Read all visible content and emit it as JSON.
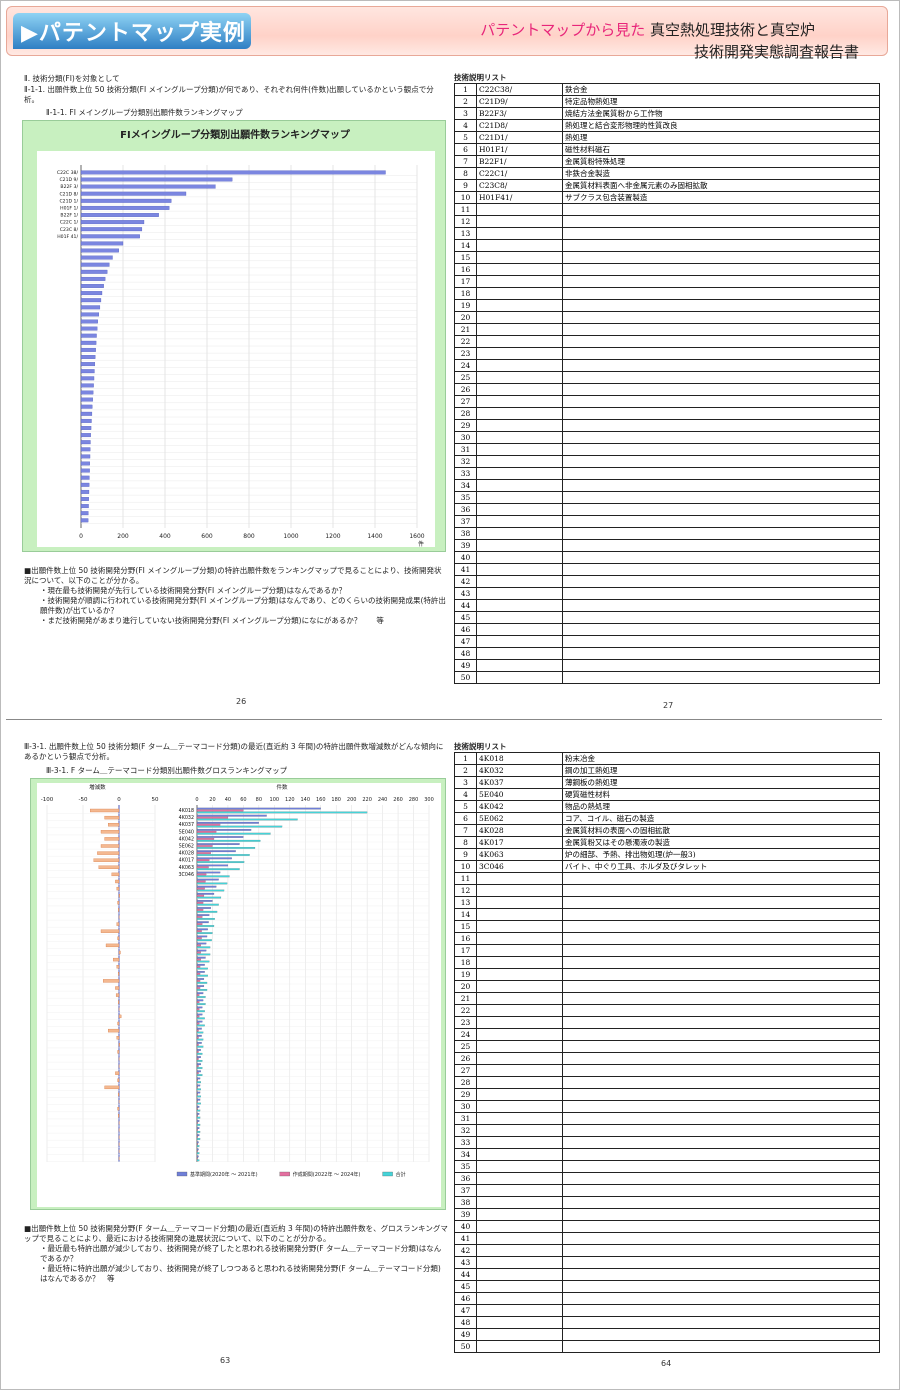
{
  "banner": {
    "title": "▶パテントマップ実例",
    "subtitle_pink": "パテントマップから見た",
    "subtitle_black": "真空熱処理技術と真空炉",
    "subtitle_line2": "技術開発実態調査報告書"
  },
  "page1": {
    "heading1": "Ⅱ. 技術分類(FI)を対象として",
    "heading2": "Ⅱ-1-1. 出願件数上位 50 技術分類(FI メイングループ分類)が何であり、それぞれ何件(件数)出願しているかという観点で分析。",
    "figure_caption": "Ⅱ-1-1. FI メイングループ分類別出願件数ランキングマップ",
    "chart_title": "FIメイングループ分類別出願件数ランキングマップ",
    "notes": [
      "■出願件数上位 50 技術開発分野(FI メイングループ分類)の特許出願件数をランキングマップで見ることにより、技術開発状況について、以下のことが分かる。",
      "・現在最も技術開発が先行している技術開発分野(FI メイングループ分類)はなんであるか？",
      "・技術開発が順調に行われている技術開発分野(FI メイングループ分類)はなんであり、どのくらいの技術開発成果(特許出願件数)が出ているか？",
      "・まだ技術開発があまり進行していない技術開発分野(FI メイングループ分類)になにがあるか？　　等"
    ],
    "page_left": "26",
    "page_right": "27",
    "list_title": "技術説明リスト",
    "list": [
      {
        "code": "C22C38/",
        "desc": "鉄合金"
      },
      {
        "code": "C21D9/",
        "desc": "特定品物熱処理"
      },
      {
        "code": "B22F3/",
        "desc": "焼結方法金属質粉から工作物"
      },
      {
        "code": "C21D8/",
        "desc": "熱処理と結合変形物理的性質改良"
      },
      {
        "code": "C21D1/",
        "desc": "熱処理"
      },
      {
        "code": "H01F1/",
        "desc": "磁性材料磁石"
      },
      {
        "code": "B22F1/",
        "desc": "金属質粉特殊処理"
      },
      {
        "code": "C22C1/",
        "desc": "非鉄合金製造"
      },
      {
        "code": "C23C8/",
        "desc": "金属質材料表面へ非金属元素のみ固相拡散"
      },
      {
        "code": "H01F41/",
        "desc": "サブクラス包含装置製造"
      }
    ]
  },
  "page2": {
    "heading": "Ⅲ-3-1. 出願件数上位 50 技術分類(F ターム＿テーマコード分類)の最近(直近約 3 年間)の特許出願件数増減数がどんな傾向にあるかという観点で分析。",
    "figure_caption": "Ⅲ-3-1. F ターム＿テーマコード分類別出願件数グロスランキングマップ",
    "notes": [
      "■出願件数上位 50 技術開発分野(F ターム＿テーマコード分類)の最近(直近約 3 年間)の特許出願件数を、グロスランキングマップで見ることにより、最近における技術開発の進展状況について、以下のことが分かる。",
      "・最近最も特許出願が減少しており、技術開発が終了したと思われる技術開発分野(F ターム＿テーマコード分類)はなんであるか？",
      "・最近特に特許出願が減少しており、技術開発が終了しつつあると思われる技術開発分野(F ターム＿テーマコード分類)はなんであるか？　等"
    ],
    "page_left": "63",
    "page_right": "64",
    "list_title": "技術説明リスト",
    "list": [
      {
        "code": "4K018",
        "desc": "粉末冶金"
      },
      {
        "code": "4K032",
        "desc": "鋼の加工熱処理"
      },
      {
        "code": "4K037",
        "desc": "薄鋼板の熱処理"
      },
      {
        "code": "5E040",
        "desc": "硬質磁性材料"
      },
      {
        "code": "4K042",
        "desc": "物品の熱処理"
      },
      {
        "code": "5E062",
        "desc": "コア、コイル、磁石の製造"
      },
      {
        "code": "4K028",
        "desc": "金属質材料の表面への固相拡散"
      },
      {
        "code": "4K017",
        "desc": "金属質粉又はその懸濁液の製造"
      },
      {
        "code": "4K063",
        "desc": "炉の細部、予熱、排出物処理(炉一般3)"
      },
      {
        "code": "3C046",
        "desc": "バイト、中ぐり工具、ホルダ及びタレット"
      }
    ]
  },
  "chart_data": [
    {
      "type": "bar",
      "title": "FIメイングループ分類別出願件数ランキングマップ",
      "xlabel": "件",
      "xlim": [
        0,
        1600
      ],
      "xticks": [
        "0",
        "200",
        "400",
        "600",
        "800",
        "1000",
        "1200",
        "1400",
        "1600"
      ],
      "categories": [
        "C22C 38/",
        "C21D 9/",
        "B22F 3/",
        "C21D 8/",
        "C21D 1/",
        "H01F 1/",
        "B22F 1/",
        "C22C 1/",
        "C23C 8/",
        "H01F 41/"
      ],
      "values": [
        1450,
        720,
        640,
        500,
        430,
        420,
        370,
        300,
        290,
        280,
        200,
        180,
        150,
        135,
        125,
        115,
        108,
        100,
        95,
        90,
        85,
        80,
        77,
        74,
        72,
        70,
        68,
        66,
        64,
        62,
        60,
        58,
        56,
        54,
        52,
        50,
        48,
        46,
        45,
        44,
        43,
        42,
        41,
        40,
        39,
        38,
        37,
        36,
        35,
        34
      ]
    },
    {
      "type": "bar",
      "title": "F ターム＿テーマコード分類別出願件数グロスランキングマップ",
      "left_axis_label": "増減数",
      "right_axis_label": "件数",
      "left_xlim": [
        -100,
        50
      ],
      "left_xticks": [
        "-100",
        "-50",
        "0",
        "50"
      ],
      "right_xlim": [
        0,
        300
      ],
      "right_xticks": [
        "0",
        "20",
        "40",
        "60",
        "80",
        "100",
        "120",
        "140",
        "160",
        "180",
        "200",
        "220",
        "240",
        "260",
        "280",
        "300"
      ],
      "categories": [
        "4K018",
        "4K032",
        "4K037",
        "5E040",
        "4K042",
        "5E062",
        "4K028",
        "4K017",
        "4K063",
        "3C046"
      ],
      "series": [
        {
          "name": "基準期間(2020年 ～ 2021年)",
          "color": "#6f7fd8",
          "values": [
            160,
            90,
            80,
            70,
            60,
            55,
            50,
            45,
            40,
            30,
            28,
            25,
            22,
            20,
            18,
            16,
            15,
            14,
            13,
            12,
            12,
            11,
            10,
            10,
            9,
            9,
            8,
            8,
            7,
            7,
            7,
            6,
            6,
            6,
            5,
            5,
            5,
            5,
            4,
            4,
            4,
            4,
            3,
            3,
            3,
            3,
            3,
            2,
            2,
            2
          ]
        },
        {
          "name": "作成期間(2022年 ～ 2024年)",
          "color": "#e46fa0",
          "values": [
            60,
            40,
            30,
            25,
            22,
            20,
            18,
            16,
            15,
            12,
            11,
            10,
            9,
            8,
            8,
            7,
            7,
            6,
            6,
            5,
            5,
            5,
            4,
            4,
            4,
            4,
            3,
            3,
            3,
            3,
            3,
            2,
            2,
            2,
            2,
            2,
            2,
            2,
            1,
            1,
            1,
            1,
            1,
            1,
            1,
            1,
            1,
            1,
            1,
            1
          ]
        },
        {
          "name": "合計",
          "color": "#45d3d8",
          "values": [
            220,
            130,
            110,
            95,
            82,
            75,
            68,
            61,
            55,
            42,
            39,
            35,
            31,
            28,
            26,
            23,
            22,
            20,
            19,
            17,
            17,
            16,
            14,
            14,
            13,
            13,
            11,
            11,
            10,
            10,
            10,
            8,
            8,
            8,
            7,
            7,
            7,
            7,
            5,
            5,
            5,
            5,
            4,
            4,
            4,
            4,
            4,
            3,
            3,
            3
          ]
        }
      ],
      "change_values": [
        -40,
        -20,
        -15,
        -25,
        -20,
        -25,
        -30,
        -35,
        -28,
        -10,
        -5,
        -3,
        1,
        -2,
        -1,
        0,
        -3,
        -25,
        -2,
        -18,
        2,
        -8,
        -3,
        -1,
        -22,
        -5,
        -4,
        -1,
        0,
        3,
        -2,
        -15,
        -3,
        1,
        -2,
        0,
        0,
        -5,
        -2,
        -20,
        -1,
        0,
        -2,
        -1,
        0,
        0,
        0,
        0,
        0,
        0
      ]
    }
  ]
}
